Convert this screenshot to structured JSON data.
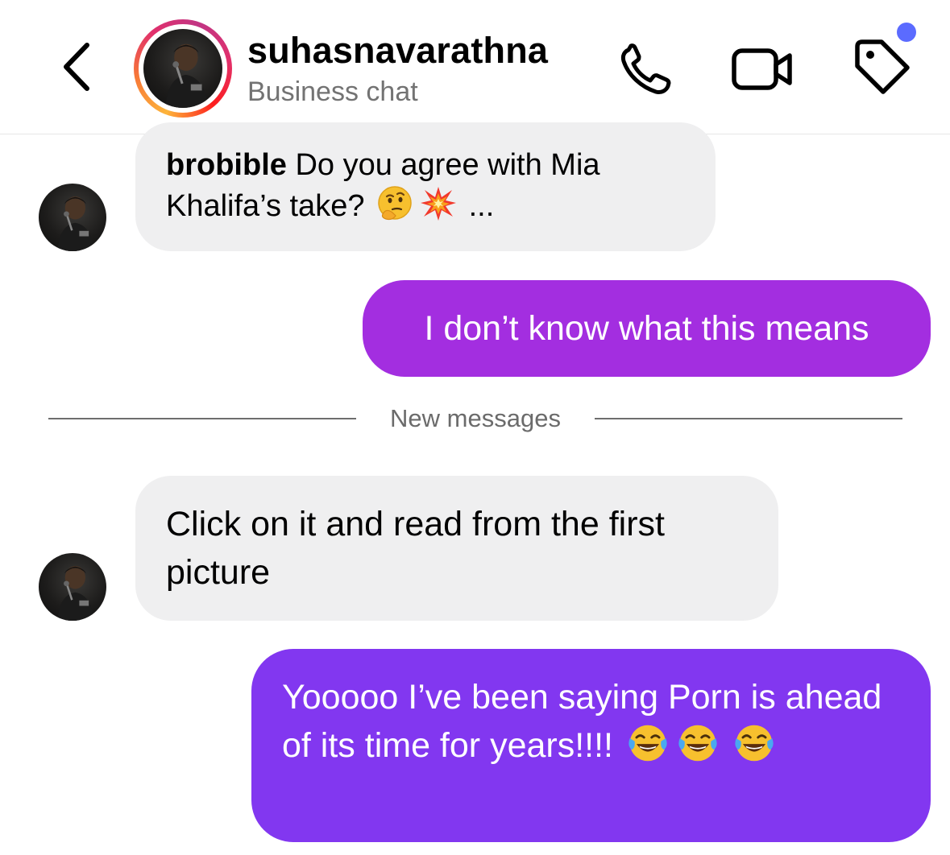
{
  "header": {
    "username": "suhasnavarathna",
    "subtitle": "Business chat",
    "icons": {
      "back": "chevron-left-icon",
      "call": "phone-icon",
      "video": "video-camera-icon",
      "tag": "tag-icon"
    },
    "story_ring_colors": [
      "#fdb43a",
      "#f77737",
      "#e1306c",
      "#c13584"
    ],
    "notification_dot_color": "#5b6bff"
  },
  "messages": [
    {
      "direction": "received",
      "sender": "brobible",
      "text": "Do you agree with Mia Khalifa’s take?",
      "emojis": [
        "thinking-face",
        "collision"
      ],
      "suffix": "..."
    },
    {
      "direction": "sent",
      "text": "I don’t know what this means"
    },
    {
      "direction": "received",
      "text": "Click on it and read from the first picture"
    },
    {
      "direction": "sent",
      "text": "Yooooo I’ve been saying Porn is ahead of its time for years!!!!",
      "emojis": [
        "face-with-tears-of-joy",
        "face-with-tears-of-joy",
        "face-with-tears-of-joy"
      ]
    }
  ],
  "divider": {
    "label": "New messages"
  },
  "colors": {
    "received_bubble": "#efeff0",
    "sent_bubble_1": "#a32ee0",
    "sent_bubble_2": "#8237f0",
    "secondary_text": "#737373"
  }
}
